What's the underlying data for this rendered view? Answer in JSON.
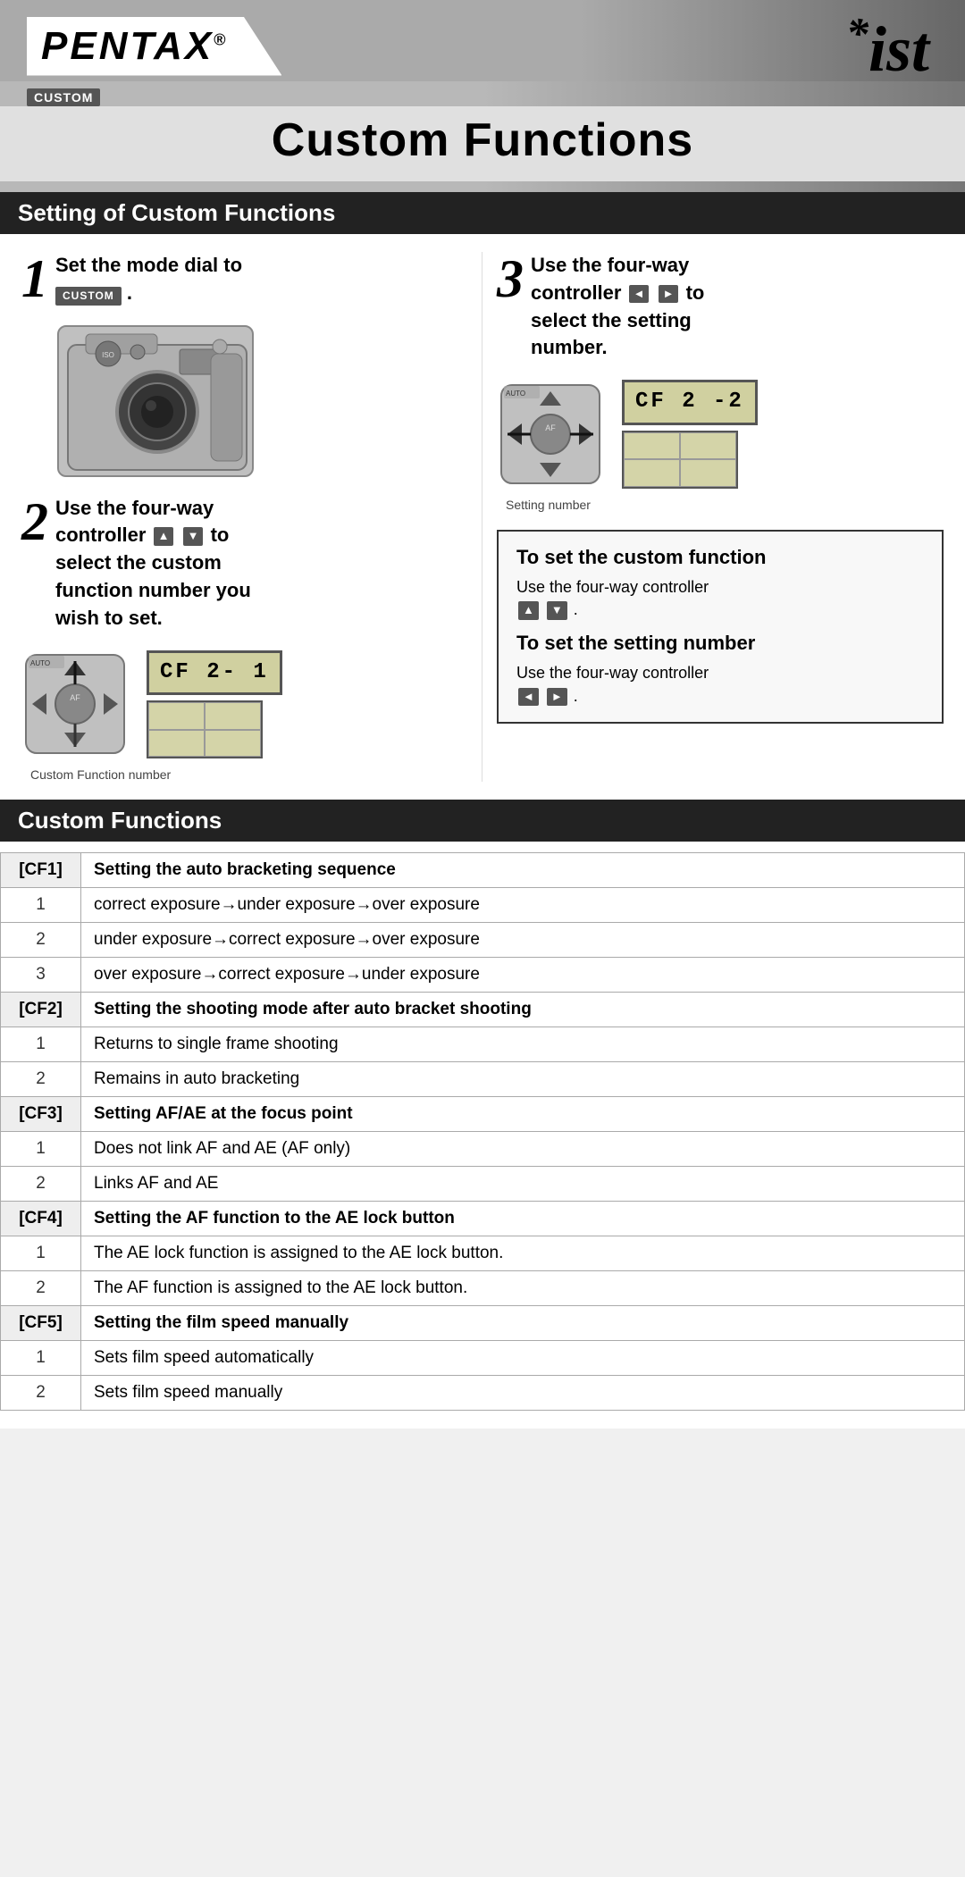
{
  "header": {
    "brand": "PENTAX",
    "registered": "®",
    "ist_star": "*",
    "ist_text": "ist",
    "custom_badge": "CUSTOM",
    "page_title": "Custom Functions"
  },
  "section1": {
    "title": "Setting of Custom Functions"
  },
  "step1": {
    "number": "1",
    "text_line1": "Set the mode dial to",
    "badge": "CUSTOM",
    "text_after": "."
  },
  "step2": {
    "number": "2",
    "text_line1": "Use the four-way",
    "text_line2": "controller",
    "arrows": "▲▼",
    "text_line3": "to",
    "text_line4": "select the custom",
    "text_line5": "function number you",
    "text_line6": "wish to set.",
    "lcd": "CF 2- 1",
    "caption": "Custom Function number"
  },
  "step3": {
    "number": "3",
    "text_line1": "Use the four-way",
    "text_line2": "controller",
    "arrows_lr": "◄►",
    "text_line3": "to",
    "text_line4": "select the setting",
    "text_line5": "number.",
    "lcd": "CF 2 -2",
    "caption": "Setting number"
  },
  "infobox": {
    "title1": "To set the custom function",
    "text1": "Use the four-way controller",
    "arrows1": "▲▼",
    "suffix1": ".",
    "title2": "To set the setting number",
    "text2": "Use the four-way controller",
    "arrows2": "◄►",
    "suffix2": "."
  },
  "section2": {
    "title": "Custom Functions"
  },
  "table": {
    "rows": [
      {
        "type": "header",
        "label": "[CF1]",
        "description": "Setting the auto bracketing sequence"
      },
      {
        "type": "data",
        "num": "1",
        "description": "correct exposure→under exposure→over exposure"
      },
      {
        "type": "data",
        "num": "2",
        "description": "under exposure→correct exposure→over exposure"
      },
      {
        "type": "data",
        "num": "3",
        "description": "over exposure→correct exposure→under exposure"
      },
      {
        "type": "header",
        "label": "[CF2]",
        "description": "Setting the shooting mode after auto bracket shooting"
      },
      {
        "type": "data",
        "num": "1",
        "description": "Returns to single frame shooting"
      },
      {
        "type": "data",
        "num": "2",
        "description": "Remains in auto bracketing"
      },
      {
        "type": "header",
        "label": "[CF3]",
        "description": "Setting AF/AE at the focus point"
      },
      {
        "type": "data",
        "num": "1",
        "description": "Does not link AF and AE (AF only)"
      },
      {
        "type": "data",
        "num": "2",
        "description": "Links AF and AE"
      },
      {
        "type": "header",
        "label": "[CF4]",
        "description": "Setting the AF function to the AE lock button"
      },
      {
        "type": "data",
        "num": "1",
        "description": "The AE lock function is assigned to the AE lock button."
      },
      {
        "type": "data",
        "num": "2",
        "description": "The AF function is assigned to the AE lock button."
      },
      {
        "type": "header",
        "label": "[CF5]",
        "description": "Setting the film speed manually"
      },
      {
        "type": "data",
        "num": "1",
        "description": "Sets film speed automatically"
      },
      {
        "type": "data",
        "num": "2",
        "description": "Sets film speed manually"
      }
    ]
  }
}
